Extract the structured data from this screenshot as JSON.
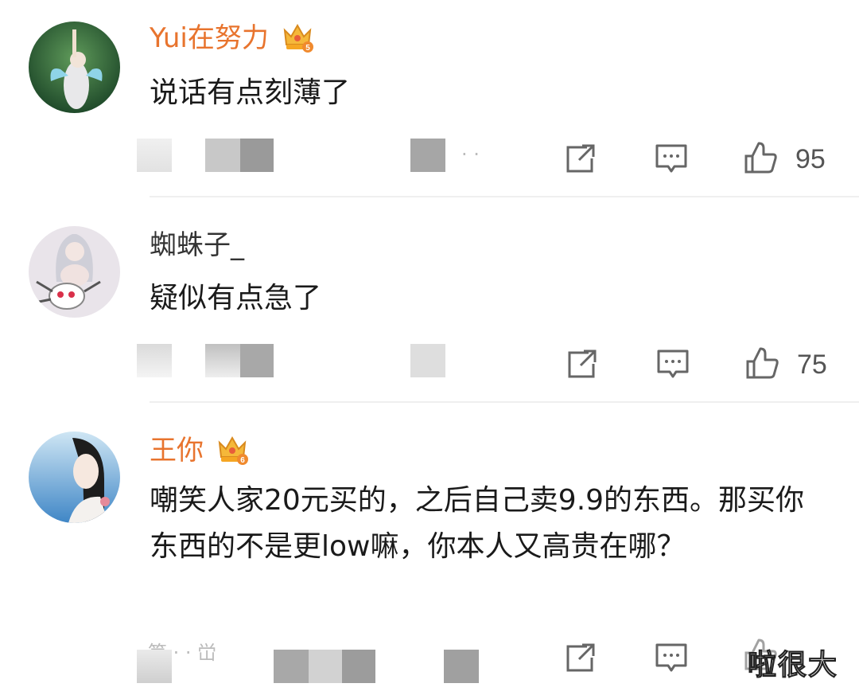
{
  "comments": [
    {
      "username": "Yui在努力",
      "vip": true,
      "vip_level": "5",
      "text": "说话有点刻薄了",
      "likes": "95"
    },
    {
      "username": "蜘蛛子_",
      "vip": false,
      "text": "疑似有点急了",
      "likes": "75"
    },
    {
      "username": "王你",
      "vip": true,
      "vip_level": "6",
      "text": "嘲笑人家20元买的，之后自己卖9.9的东西。那买你东西的不是更low嘛，你本人又高贵在哪？",
      "likes": ""
    }
  ],
  "watermark": "啦很大",
  "icons": {
    "share": "share-icon",
    "comment": "comment-icon",
    "like": "thumbs-up-icon",
    "vip": "crown-icon"
  },
  "colors": {
    "vip_name": "#e8742e",
    "normal_name": "#333333",
    "icon": "#666666"
  }
}
